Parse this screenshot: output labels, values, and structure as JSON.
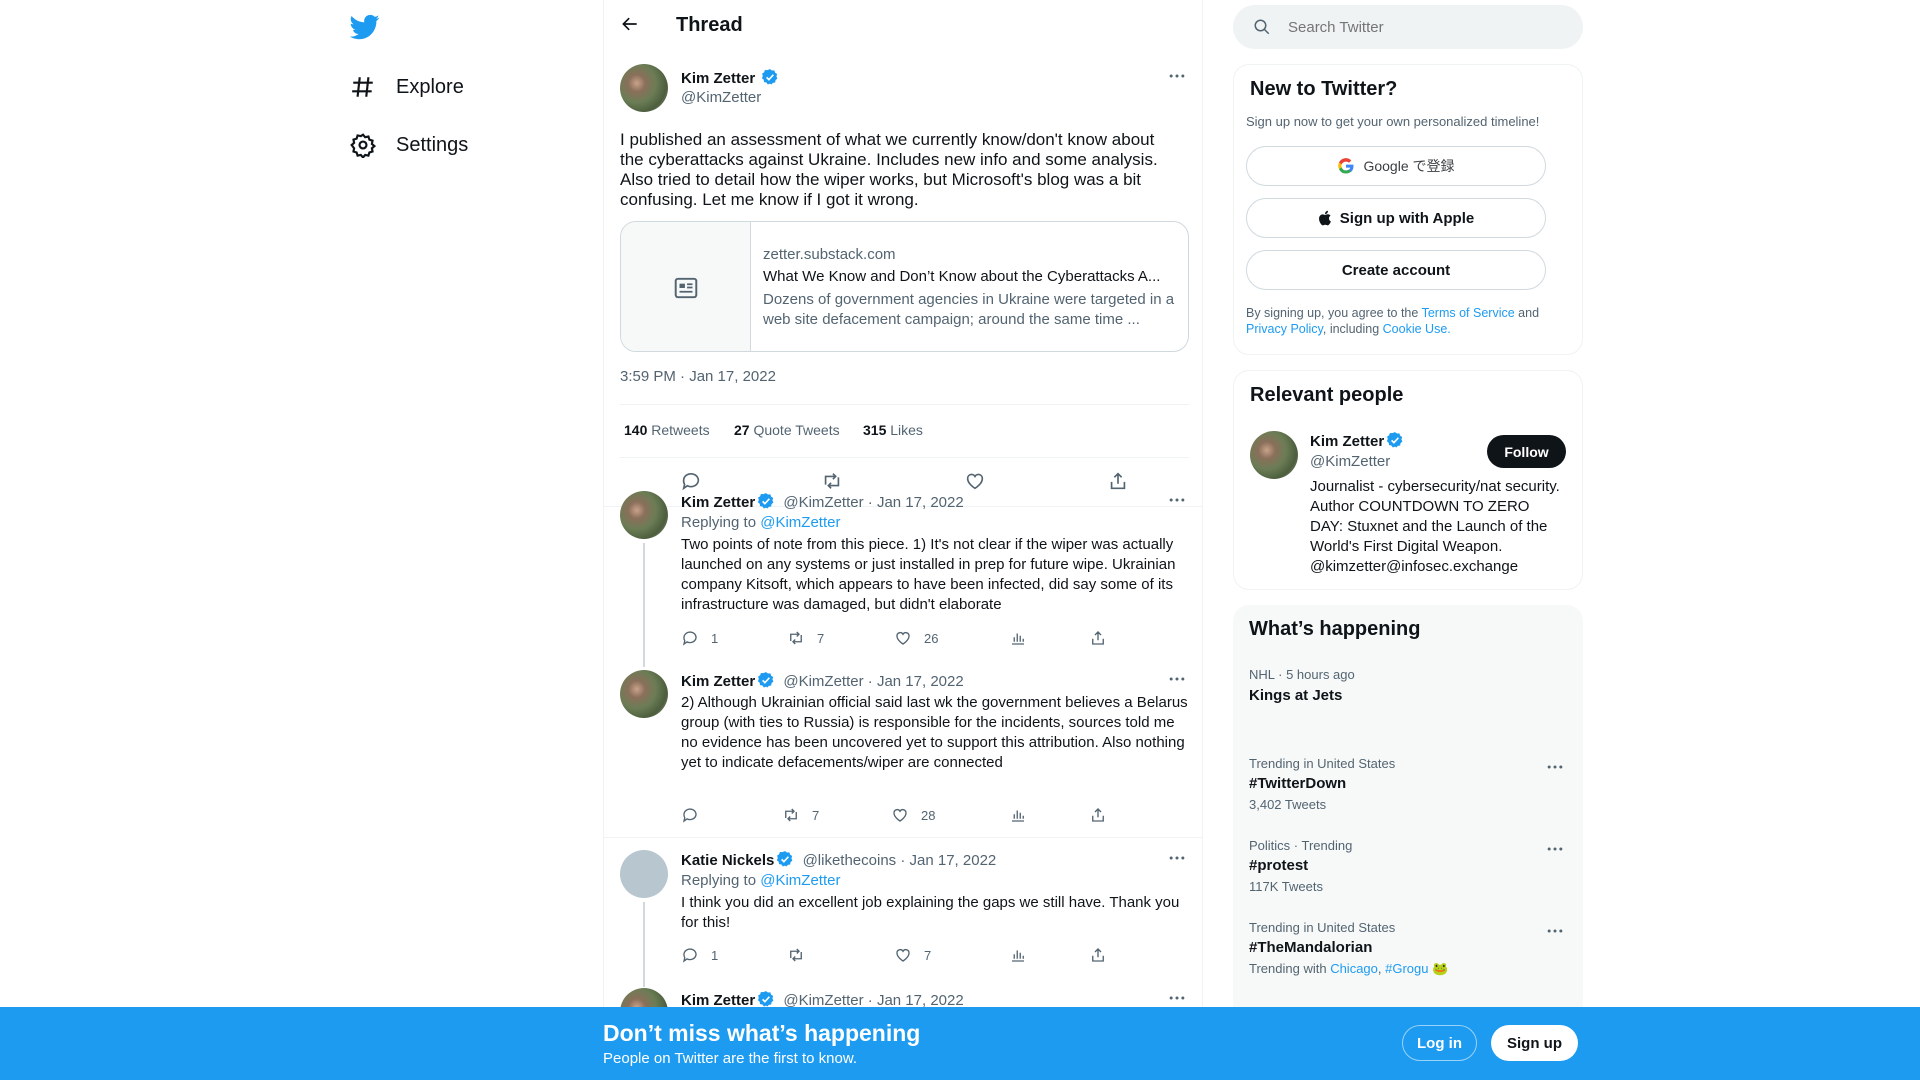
{
  "nav": {
    "items": [
      {
        "label": "Explore"
      },
      {
        "label": "Settings"
      }
    ]
  },
  "header": {
    "title": "Thread"
  },
  "main_tweet": {
    "name": "Kim Zetter",
    "handle": "@KimZetter",
    "text": "I published an assessment of what we currently know/don't know about the cyberattacks against Ukraine. Includes new info and some analysis. Also tried to detail how the wiper works, but Microsoft's blog was a bit confusing. Let me know if I got it wrong.",
    "card": {
      "domain": "zetter.substack.com",
      "title": "What We Know and Don’t Know about the Cyberattacks A...",
      "description": "Dozens of government agencies in Ukraine were targeted in a web site defacement campaign; around the same time ..."
    },
    "timestamp": "3:59 PM · Jan 17, 2022",
    "stats": {
      "retweets_count": "140",
      "retweets_label": "Retweets",
      "quotes_count": "27",
      "quotes_label": "Quote Tweets",
      "likes_count": "315",
      "likes_label": "Likes"
    }
  },
  "replies": [
    {
      "name": "Kim Zetter",
      "handle": "@KimZetter",
      "date": "· Jan 17, 2022",
      "replying_prefix": "Replying to",
      "replying_to": "@KimZetter",
      "text": "Two points of note from this piece. 1) It's not clear if the wiper was actually launched on any systems or just installed in prep for future wipe. Ukrainian company Kitsoft, which appears to have been infected, did say some of its infrastructure was damaged, but didn't elaborate",
      "reply_count": "1",
      "retweet_count": "7",
      "like_count": "26"
    },
    {
      "name": "Kim Zetter",
      "handle": "@KimZetter",
      "date": "· Jan 17, 2022",
      "text": "2) Although Ukrainian official said last wk the government believes a Belarus group (with ties to Russia) is responsible for the incidents, sources told me no evidence has been uncovered yet to support this attribution. Also nothing yet to indicate defacements/wiper are connected",
      "reply_count": "",
      "retweet_count": "7",
      "like_count": "28"
    },
    {
      "name": "Katie Nickels",
      "handle": "@likethecoins",
      "date": "· Jan 17, 2022",
      "replying_prefix": "Replying to",
      "replying_to": "@KimZetter",
      "text": "I think you did an excellent job explaining the gaps we still have. Thank you for this!",
      "reply_count": "1",
      "retweet_count": "",
      "like_count": "7"
    },
    {
      "name": "Kim Zetter",
      "handle": "@KimZetter",
      "date": "· Jan 17, 2022"
    }
  ],
  "search": {
    "placeholder": "Search Twitter"
  },
  "signup": {
    "title": "New to Twitter?",
    "subtitle": "Sign up now to get your own personalized timeline!",
    "google_label": "Google で登録",
    "apple_label": "Sign up with Apple",
    "create_label": "Create account",
    "legal_prefix": "By signing up, you agree to the",
    "terms": "Terms of Service",
    "and": "and",
    "privacy": "Privacy Policy",
    "including": ", including",
    "cookie": "Cookie Use."
  },
  "relevant": {
    "title": "Relevant people",
    "name": "Kim Zetter",
    "handle": "@KimZetter",
    "follow_label": "Follow",
    "bio": "Journalist - cybersecurity/nat security. Author COUNTDOWN TO ZERO DAY: Stuxnet and the Launch of the World's First Digital Weapon. @kimzetter@infosec.exchange"
  },
  "happening": {
    "title": "What’s happening",
    "items": [
      {
        "context": "NHL · 5 hours ago",
        "title": "Kings at Jets"
      },
      {
        "context": "Trending in United States",
        "title": "#TwitterDown",
        "meta": "3,402 Tweets"
      },
      {
        "context": "Politics · Trending",
        "title": "#protest",
        "meta": "117K Tweets"
      },
      {
        "context": "Trending in United States",
        "title": "#TheMandalorian",
        "meta_prefix": "Trending with",
        "link1": "Chicago",
        "link2": "#Grogu"
      }
    ]
  },
  "bottom": {
    "title": "Don’t miss what’s happening",
    "subtitle": "People on Twitter are the first to know.",
    "login_label": "Log in",
    "signup_label": "Sign up"
  },
  "colors": {
    "accent": "#1d9bf0",
    "text": "#0f1419",
    "muted": "#536471"
  }
}
